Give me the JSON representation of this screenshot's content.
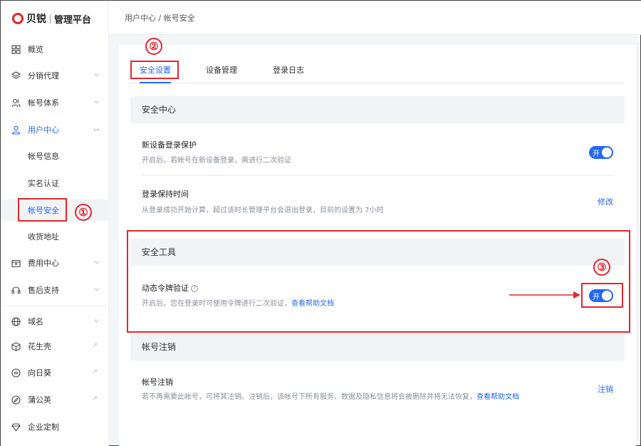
{
  "brand": {
    "name": "贝锐",
    "subtitle": "管理平台",
    "color": "#e3262f"
  },
  "sidebar": {
    "items": [
      {
        "label": "概览",
        "icon": "dashboard-icon"
      },
      {
        "label": "分销代理",
        "icon": "layers-icon"
      },
      {
        "label": "帐号体系",
        "icon": "users-icon"
      },
      {
        "label": "用户中心",
        "icon": "user-icon"
      },
      {
        "label": "费用中心",
        "icon": "wallet-icon"
      },
      {
        "label": "售后支持",
        "icon": "headset-icon"
      },
      {
        "label": "域名",
        "icon": "globe-icon"
      },
      {
        "label": "花生壳",
        "icon": "cube-icon"
      },
      {
        "label": "向日葵",
        "icon": "sunflower-icon"
      },
      {
        "label": "蒲公英",
        "icon": "dandelion-icon"
      },
      {
        "label": "企业定制",
        "icon": "diamond-icon"
      }
    ],
    "sub_items": [
      {
        "label": "帐号信息"
      },
      {
        "label": "实名认证"
      },
      {
        "label": "帐号安全"
      },
      {
        "label": "收货地址"
      }
    ]
  },
  "breadcrumb": "用户中心 / 帐号安全",
  "tabs": [
    {
      "label": "安全设置"
    },
    {
      "label": "设备管理"
    },
    {
      "label": "登录日志"
    }
  ],
  "sections": {
    "security_center": {
      "title": "安全中心",
      "new_device": {
        "title": "新设备登录保护",
        "desc": "开启后，若帐号在新设备登录，需进行二次验证",
        "toggle_label": "开"
      },
      "session_time": {
        "title": "登录保持时间",
        "desc": "从登录成功开始计算，超过该时长管理平台会退出登录，目前的设置为 7小时",
        "action": "修改"
      }
    },
    "security_tools": {
      "title": "安全工具",
      "token": {
        "title": "动态令牌验证",
        "desc": "开启后，您在登录时可使用令牌进行二次验证，",
        "help_link": "查看帮助文档",
        "toggle_label": "开"
      }
    },
    "account_cancel": {
      "title": "帐号注销",
      "item": {
        "title": "帐号注销",
        "desc": "若不再需要此帐号，可将其注销。注销后，该帐号下所有服务、数据及隐私信息将会被删除并将无法恢复，",
        "help_link": "查看帮助文档",
        "action": "注销"
      }
    }
  },
  "annotations": {
    "markers": [
      "①",
      "②",
      "③"
    ],
    "color": "#e3262f"
  },
  "colors": {
    "accent": "#2468f2",
    "annotation": "#e3262f"
  }
}
